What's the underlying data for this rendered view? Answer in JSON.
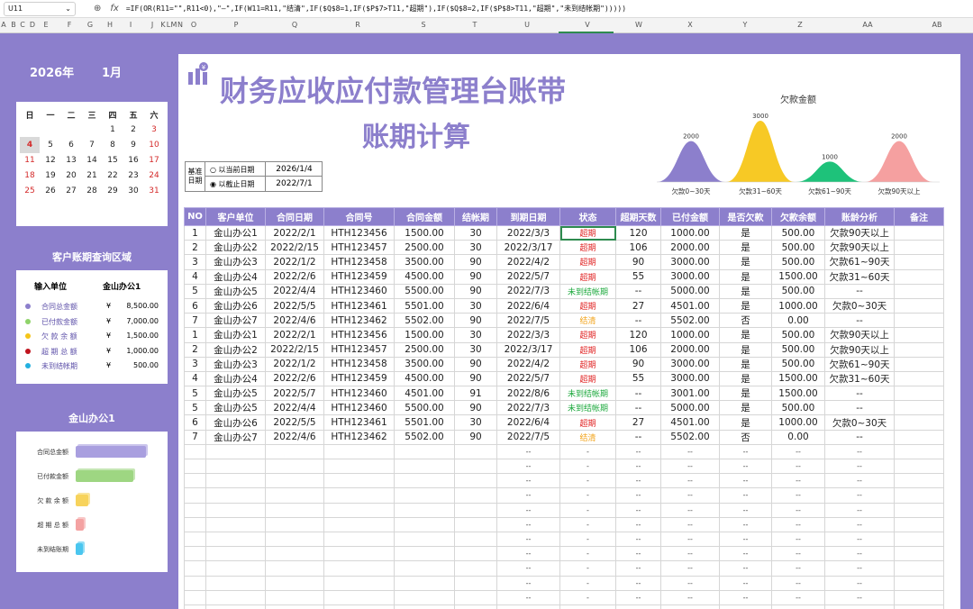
{
  "formula_bar": {
    "cell_ref": "U11",
    "zoom_icon": "magnifier-icon",
    "fx_label": "fx",
    "formula": "=IF(OR(R11=\"\",R11<0),\"—\",IF(W11=R11,\"结清\",IF($Q$8=1,IF($P$7>T11,\"超期\"),IF($Q$8=2,IF($P$8>T11,\"超期\",\"未到结帐期\")))))"
  },
  "column_letters": [
    "A",
    "B",
    "C",
    "D",
    "E",
    "F",
    "G",
    "H",
    "I",
    "J",
    "K",
    "L",
    "M",
    "N",
    "O",
    "P",
    "Q",
    "R",
    "S",
    "T",
    "U",
    "V",
    "W",
    "X",
    "Y",
    "Z",
    "AA",
    "AB"
  ],
  "calendar": {
    "year": "2026年",
    "month": "1月",
    "weekdays": [
      "日",
      "一",
      "二",
      "三",
      "四",
      "五",
      "六"
    ],
    "weeks": [
      [
        "",
        "",
        "",
        "",
        "1",
        "2",
        "3"
      ],
      [
        "4",
        "5",
        "6",
        "7",
        "8",
        "9",
        "10"
      ],
      [
        "11",
        "12",
        "13",
        "14",
        "15",
        "16",
        "17"
      ],
      [
        "18",
        "19",
        "20",
        "21",
        "22",
        "23",
        "24"
      ],
      [
        "25",
        "26",
        "27",
        "28",
        "29",
        "30",
        "31"
      ]
    ],
    "today": "4"
  },
  "query": {
    "title": "客户账期查询区域",
    "input_label": "输入单位",
    "input_value": "金山办公1",
    "rows": [
      {
        "label": "合同总金额",
        "currency": "¥",
        "value": "8,500.00",
        "color": "#8c7fcc"
      },
      {
        "label": "已付款金额",
        "currency": "¥",
        "value": "7,000.00",
        "color": "#8fd36a"
      },
      {
        "label": "欠 款 余 额",
        "currency": "¥",
        "value": "1,500.00",
        "color": "#f5c518"
      },
      {
        "label": "超 期 总 额",
        "currency": "¥",
        "value": "1,000.00",
        "color": "#c0141e"
      },
      {
        "label": "未到结帐期",
        "currency": "¥",
        "value": "500.00",
        "color": "#23b0e0"
      }
    ]
  },
  "bar_panel": {
    "title": "金山办公1",
    "chart_data": {
      "type": "bar",
      "categories": [
        "合同总金额",
        "已付款金额",
        "欠 款 余 额",
        "超 期 总 额",
        "未到结账期"
      ],
      "values": [
        8500,
        7000,
        1500,
        1000,
        500
      ],
      "colors": [
        "#a99fdf",
        "#9ed682",
        "#f7d35c",
        "#f4a2a2",
        "#4ac6ef"
      ]
    }
  },
  "header": {
    "title": "财务应收应付款管理台账带",
    "subtitle": "账期计算"
  },
  "base_date": {
    "label": "基准日期",
    "option1": "以当前日期",
    "date1": "2026/1/4",
    "option2": "以截止日期",
    "date2": "2022/7/1"
  },
  "area_chart": {
    "chart_data": {
      "type": "area",
      "title": "欠款金额",
      "categories": [
        "欠款0~30天",
        "欠款31~60天",
        "欠款61~90天",
        "欠款90天以上"
      ],
      "values": [
        2000,
        3000,
        1000,
        2000
      ],
      "colors": [
        "#8c7fcc",
        "#f7c925",
        "#1ec27a",
        "#f5a0a0"
      ]
    }
  },
  "table": {
    "headers": [
      "NO",
      "客户单位",
      "合同日期",
      "合同号",
      "合同金额",
      "结帐期",
      "到期日期",
      "状态",
      "超期天数",
      "已付金额",
      "是否欠款",
      "欠款余额",
      "账龄分析",
      "备注"
    ],
    "rows": [
      [
        "1",
        "金山办公1",
        "2022/2/1",
        "HTH123456",
        "1500.00",
        "30",
        "2022/3/3",
        "超期",
        "120",
        "1000.00",
        "是",
        "500.00",
        "欠款90天以上",
        ""
      ],
      [
        "2",
        "金山办公2",
        "2022/2/15",
        "HTH123457",
        "2500.00",
        "30",
        "2022/3/17",
        "超期",
        "106",
        "2000.00",
        "是",
        "500.00",
        "欠款90天以上",
        ""
      ],
      [
        "3",
        "金山办公3",
        "2022/1/2",
        "HTH123458",
        "3500.00",
        "90",
        "2022/4/2",
        "超期",
        "90",
        "3000.00",
        "是",
        "500.00",
        "欠款61~90天",
        ""
      ],
      [
        "4",
        "金山办公4",
        "2022/2/6",
        "HTH123459",
        "4500.00",
        "90",
        "2022/5/7",
        "超期",
        "55",
        "3000.00",
        "是",
        "1500.00",
        "欠款31~60天",
        ""
      ],
      [
        "5",
        "金山办公5",
        "2022/4/4",
        "HTH123460",
        "5500.00",
        "90",
        "2022/7/3",
        "未到结帐期",
        "--",
        "5000.00",
        "是",
        "500.00",
        "--",
        ""
      ],
      [
        "6",
        "金山办公6",
        "2022/5/5",
        "HTH123461",
        "5501.00",
        "30",
        "2022/6/4",
        "超期",
        "27",
        "4501.00",
        "是",
        "1000.00",
        "欠款0~30天",
        ""
      ],
      [
        "7",
        "金山办公7",
        "2022/4/6",
        "HTH123462",
        "5502.00",
        "90",
        "2022/7/5",
        "结清",
        "--",
        "5502.00",
        "否",
        "0.00",
        "--",
        ""
      ],
      [
        "1",
        "金山办公1",
        "2022/2/1",
        "HTH123456",
        "1500.00",
        "30",
        "2022/3/3",
        "超期",
        "120",
        "1000.00",
        "是",
        "500.00",
        "欠款90天以上",
        ""
      ],
      [
        "2",
        "金山办公2",
        "2022/2/15",
        "HTH123457",
        "2500.00",
        "30",
        "2022/3/17",
        "超期",
        "106",
        "2000.00",
        "是",
        "500.00",
        "欠款90天以上",
        ""
      ],
      [
        "3",
        "金山办公3",
        "2022/1/2",
        "HTH123458",
        "3500.00",
        "90",
        "2022/4/2",
        "超期",
        "90",
        "3000.00",
        "是",
        "500.00",
        "欠款61~90天",
        ""
      ],
      [
        "4",
        "金山办公4",
        "2022/2/6",
        "HTH123459",
        "4500.00",
        "90",
        "2022/5/7",
        "超期",
        "55",
        "3000.00",
        "是",
        "1500.00",
        "欠款31~60天",
        ""
      ],
      [
        "5",
        "金山办公5",
        "2022/5/7",
        "HTH123460",
        "4501.00",
        "91",
        "2022/8/6",
        "未到结帐期",
        "--",
        "3001.00",
        "是",
        "1500.00",
        "--",
        ""
      ],
      [
        "5",
        "金山办公5",
        "2022/4/4",
        "HTH123460",
        "5500.00",
        "90",
        "2022/7/3",
        "未到结帐期",
        "--",
        "5000.00",
        "是",
        "500.00",
        "--",
        ""
      ],
      [
        "6",
        "金山办公6",
        "2022/5/5",
        "HTH123461",
        "5501.00",
        "30",
        "2022/6/4",
        "超期",
        "27",
        "4501.00",
        "是",
        "1000.00",
        "欠款0~30天",
        ""
      ],
      [
        "7",
        "金山办公7",
        "2022/4/6",
        "HTH123462",
        "5502.00",
        "90",
        "2022/7/5",
        "结清",
        "--",
        "5502.00",
        "否",
        "0.00",
        "--",
        ""
      ]
    ],
    "empty_rows": 12,
    "empty_text": {
      "due": "--",
      "status": "-",
      "overdue": "--",
      "paid": "--",
      "owe": "--",
      "balance": "--",
      "aging": "--"
    }
  },
  "status_colors": {
    "超期": "#e02020",
    "未到结帐期": "#1aa83b",
    "结清": "#f2a31a"
  }
}
